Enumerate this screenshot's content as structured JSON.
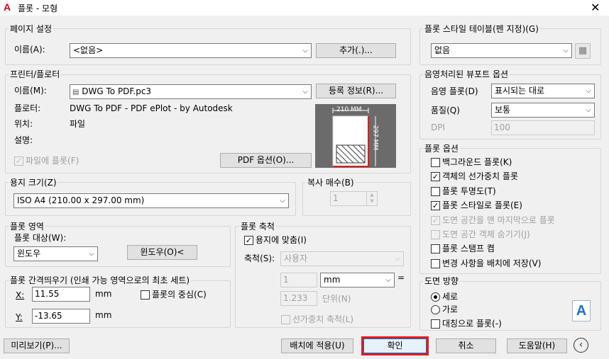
{
  "window": {
    "title": "플롯 - 모형",
    "app_icon": "A",
    "close_glyph": "✕"
  },
  "page_setup": {
    "title": "페이지 설정",
    "name_label": "이름(A):",
    "name_value": "<없음>",
    "add_button": "추가(.)..."
  },
  "printer": {
    "title": "프린터/플로터",
    "name_label": "이름(M):",
    "name_value": "DWG To PDF.pc3",
    "properties_button": "등록 정보(R)...",
    "plotter_label": "플로터:",
    "plotter_value": "DWG To PDF - PDF ePlot - by Autodesk",
    "location_label": "위치:",
    "location_value": "파일",
    "description_label": "설명:",
    "plot_to_file_label": "파일에 플롯(F)",
    "pdf_options_button": "PDF 옵션(O)...",
    "preview_width": "210 MM",
    "preview_height": "297 MM"
  },
  "paper_size": {
    "title": "용지 크기(Z)",
    "value": "ISO A4 (210.00 x 297.00 mm)"
  },
  "copies": {
    "title": "복사 매수(B)",
    "value": "1"
  },
  "plot_area": {
    "title": "플롯 영역",
    "what_label": "플롯 대상(W):",
    "what_value": "윈도우",
    "window_button": "윈도우(O)<"
  },
  "plot_offset": {
    "title": "플롯 간격띄우기 (인쇄 가능 영역으로의 최초 세트)",
    "x_label": "X:",
    "x_value": "11.55",
    "x_unit": "mm",
    "y_label": "Y:",
    "y_value": "-13.65",
    "y_unit": "mm",
    "center_label": "플롯의 중심(C)"
  },
  "plot_scale": {
    "title": "플롯 축척",
    "fit_label": "용지에 맞춤(I)",
    "scale_label": "축척(S):",
    "scale_value": "사용자",
    "value1": "1",
    "unit_value": "mm",
    "equals": "=",
    "value2": "1.233",
    "units_label": "단위(N)",
    "lineweights_label": "선가중치 축척(L)"
  },
  "style_table": {
    "title": "플롯 스타일 테이블(펜 지정)(G)",
    "value": "없음"
  },
  "shaded_viewport": {
    "title": "음영처리된 뷰포트 옵션",
    "shade_label": "음영 플롯(D)",
    "shade_value": "표시되는 대로",
    "quality_label": "품질(Q)",
    "quality_value": "보통",
    "dpi_label": "DPI",
    "dpi_value": "100"
  },
  "plot_options": {
    "title": "플롯 옵션",
    "items": [
      {
        "label": "백그라운드 플롯(K)",
        "checked": false,
        "disabled": false
      },
      {
        "label": "객체의 선가중치 플롯",
        "checked": true,
        "disabled": false
      },
      {
        "label": "플롯 투명도(T)",
        "checked": false,
        "disabled": false
      },
      {
        "label": "플롯 스타일로 플롯(E)",
        "checked": true,
        "disabled": false
      },
      {
        "label": "도면 공간을 맨 마지막으로 플롯",
        "checked": true,
        "disabled": true
      },
      {
        "label": "도면 공간 객체 숨기기(J)",
        "checked": false,
        "disabled": true
      },
      {
        "label": "플롯 스탬프 켬",
        "checked": false,
        "disabled": false
      },
      {
        "label": "변경 사항을 배치에 저장(V)",
        "checked": false,
        "disabled": false
      }
    ]
  },
  "orientation": {
    "title": "도면 방향",
    "portrait": "세로",
    "landscape": "가로",
    "upside_down": "대칭으로 플롯(-)",
    "icon_letter": "A"
  },
  "footer": {
    "preview_button": "미리보기(P)...",
    "apply_button": "배치에 적용(U)",
    "ok_button": "확인",
    "cancel_button": "취소",
    "help_button": "도움말(H)",
    "more_glyph": "‹"
  }
}
